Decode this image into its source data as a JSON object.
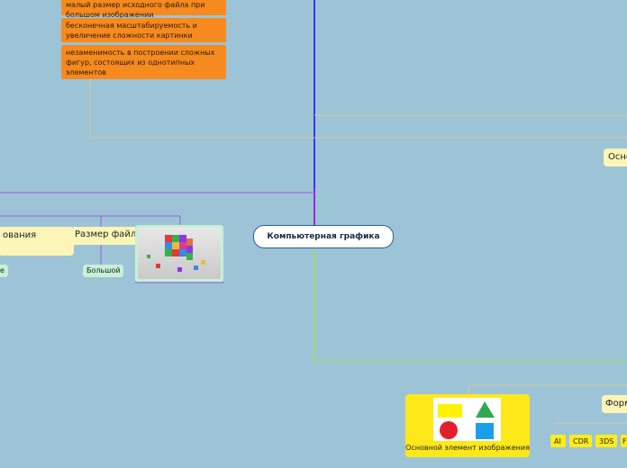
{
  "center_node": {
    "label": "Компьютерная графика"
  },
  "advantages": [
    "малый размер исходного файла при большом изображении",
    "бесконечная масштабируемость и увеличение сложности картинки",
    "незаменимость в построении сложных фигур, состоящих из однотипных элементов"
  ],
  "left_branch": {
    "node1": "ования",
    "node2": "Размер файла",
    "tag1": "е",
    "tag2": "Большой"
  },
  "right_nodes": {
    "top": "Осно",
    "bottom": "Форм"
  },
  "shapes_card": {
    "caption": "Основной элемент изображения"
  },
  "format_tags": [
    "AI",
    "CDR",
    "3DS",
    "F"
  ],
  "colors": {
    "background": "#9dc4d6",
    "orange": "#f68a1f",
    "yellow": "#ffe81a",
    "line_blue": "#3a3ae0",
    "line_purple": "#9a3ae0",
    "line_green": "#8fe060"
  }
}
